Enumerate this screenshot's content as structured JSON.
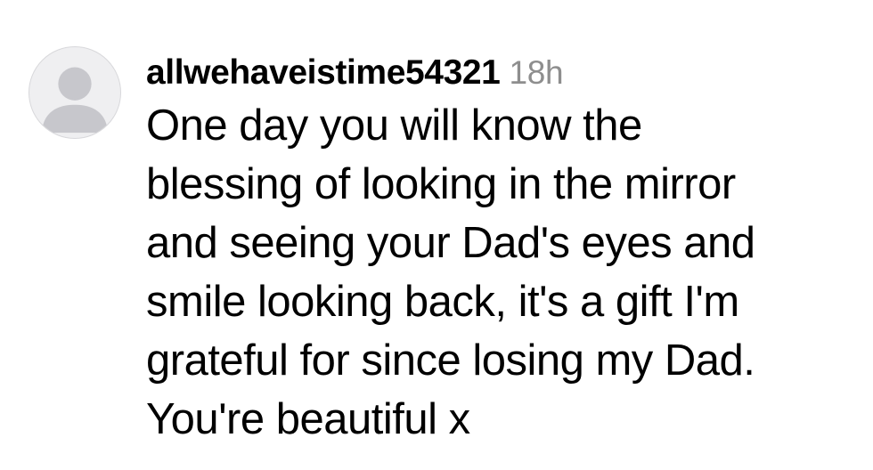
{
  "comment": {
    "username": "allwehaveistime54321",
    "timestamp": "18h",
    "avatar_icon": "default-user-avatar-icon",
    "text_lines": [
      "One day you will know the",
      "blessing of looking in the mirror",
      "and seeing your Dad's eyes and",
      "smile looking back, it's a gift I'm",
      "grateful for since losing my Dad.",
      "You're beautiful x"
    ]
  },
  "colors": {
    "text": "#000000",
    "timestamp": "#8e8e8e",
    "avatar_bg": "#efeff1",
    "avatar_silhouette": "#c7c7cc"
  }
}
